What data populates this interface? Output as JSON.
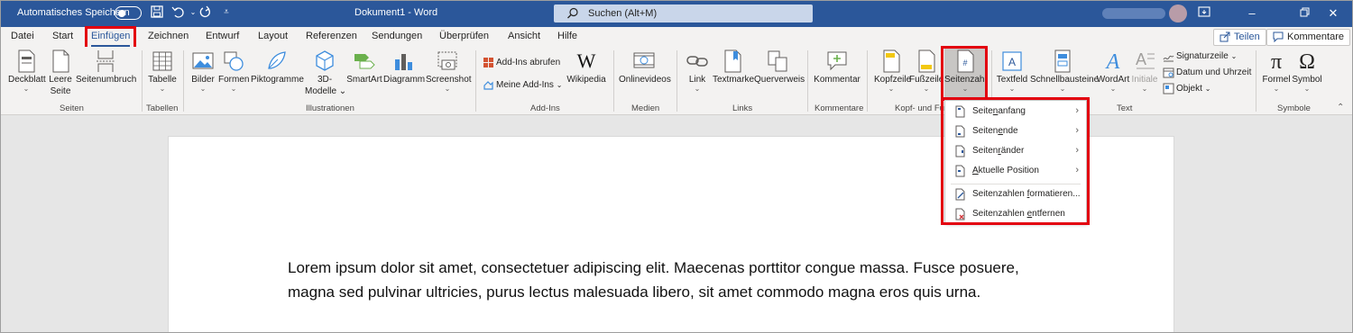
{
  "titlebar": {
    "autosave_label": "Automatisches Speichern",
    "document_title": "Dokument1 - Word",
    "search_placeholder": "Suchen (Alt+M)"
  },
  "tabs": [
    {
      "label": "Datei"
    },
    {
      "label": "Start"
    },
    {
      "label": "Einfügen"
    },
    {
      "label": "Zeichnen"
    },
    {
      "label": "Entwurf"
    },
    {
      "label": "Layout"
    },
    {
      "label": "Referenzen"
    },
    {
      "label": "Sendungen"
    },
    {
      "label": "Überprüfen"
    },
    {
      "label": "Ansicht"
    },
    {
      "label": "Hilfe"
    }
  ],
  "active_tab": "Einfügen",
  "share_label": "Teilen",
  "comments_label": "Kommentare",
  "ribbon": {
    "deckblatt": "Deckblatt",
    "leere_seite_1": "Leere",
    "leere_seite_2": "Seite",
    "seitenumbruch": "Seitenumbruch",
    "tabelle": "Tabelle",
    "bilder": "Bilder",
    "formen": "Formen",
    "piktogramme": "Piktogramme",
    "modelle_1": "3D-",
    "modelle_2": "Modelle",
    "smartart": "SmartArt",
    "diagramm": "Diagramm",
    "screenshot": "Screenshot",
    "addins_abrufen": "Add-Ins abrufen",
    "meine_addins": "Meine Add-Ins",
    "wikipedia": "Wikipedia",
    "onlinevideos": "Onlinevideos",
    "link": "Link",
    "textmarke": "Textmarke",
    "querverweis": "Querverweis",
    "kommentar": "Kommentar",
    "kopfzeile": "Kopfzeile",
    "fusszeile": "Fußzeile",
    "seitenzahl": "Seitenzahl",
    "textfeld": "Textfeld",
    "schnellbausteine": "Schnellbausteine",
    "wordart": "WordArt",
    "initiale": "Initiale",
    "signaturzeile": "Signaturzeile",
    "datum_uhrzeit": "Datum und Uhrzeit",
    "objekt": "Objekt",
    "formel": "Formel",
    "symbol": "Symbol"
  },
  "groups": {
    "seiten": "Seiten",
    "tabellen": "Tabellen",
    "illustrationen": "Illustrationen",
    "addins": "Add-Ins",
    "medien": "Medien",
    "links": "Links",
    "kommentare": "Kommentare",
    "kopf_fuss": "Kopf- und Fu",
    "text": "Text",
    "symbole": "Symbole"
  },
  "dropdown": {
    "items": [
      {
        "pre": "Seite",
        "ul": "n",
        "post": "anfang",
        "submenu": true
      },
      {
        "pre": "Seiten",
        "ul": "e",
        "post": "nde",
        "submenu": true
      },
      {
        "pre": "Seiten",
        "ul": "r",
        "post": "änder",
        "submenu": true
      },
      {
        "pre": "",
        "ul": "A",
        "post": "ktuelle Position",
        "submenu": true
      },
      {
        "pre": "Seitenzahlen ",
        "ul": "f",
        "post": "ormatieren...",
        "submenu": false
      },
      {
        "pre": "Seitenzahlen ",
        "ul": "e",
        "post": "ntfernen",
        "submenu": false
      }
    ]
  },
  "document": {
    "paragraph": "Lorem ipsum dolor sit amet, consectetuer adipiscing elit. Maecenas porttitor congue massa. Fusce posuere, magna sed pulvinar ultricies, purus lectus malesuada libero, sit amet commodo magna eros quis urna."
  },
  "colors": {
    "titlebar": "#2b579a",
    "highlight_box": "#e3000f"
  }
}
